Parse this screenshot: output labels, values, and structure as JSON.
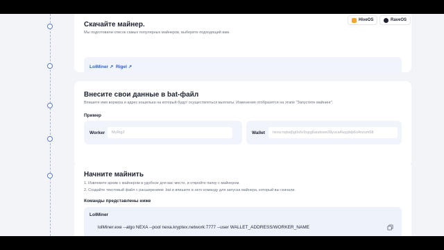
{
  "step1": {
    "title": "Скачайте майнер.",
    "description": "Мы подготовили список самых популярных майнеров, выберите подходящий вам.",
    "os_chips": [
      {
        "label": "HiveOS",
        "icon": "hiveos-icon",
        "color": "#f5a623"
      },
      {
        "label": "RaveOS",
        "icon": "raveos-icon",
        "color": "#1e2230"
      }
    ],
    "links": [
      "LolMiner ↗",
      "Rigel ↗"
    ]
  },
  "step2": {
    "title": "Внесите свои данные в bat-файл",
    "description": "Впишите имя воркера и адрес кошелька на который будут осуществляться выплаты. Изменения отобразятся на этапе \"Запустите майнинг\".",
    "example_label": "Пример",
    "worker": {
      "label": "Worker",
      "placeholder": "MyRig2"
    },
    "wallet": {
      "label": "Wallet",
      "placeholder": "nexa:nqtsq5g0s6v9upg6audswe28yuca4wyjddp6u4nzum58"
    }
  },
  "step3": {
    "title": "Начните майнить",
    "instructions": [
      "1. Извлеките архив с майнером в удобное для вас место, и откройте папку с майнером.",
      "2. Создайте текстовый файл с расширением .bat и впишите в него команду для запуска майнера, который вы скачали."
    ],
    "commands_label": "Команды представлены ниже",
    "miner_name": "LolMiner",
    "command": "lolMiner.exe --algo NEXA --pool nexa.kryptex.network:7777 --user WALLET_ADDRESS/WORKER_NAME"
  },
  "colors": {
    "accent": "#2f61c9",
    "background": "#f3f4f8",
    "panel": "#f1f4fb"
  }
}
